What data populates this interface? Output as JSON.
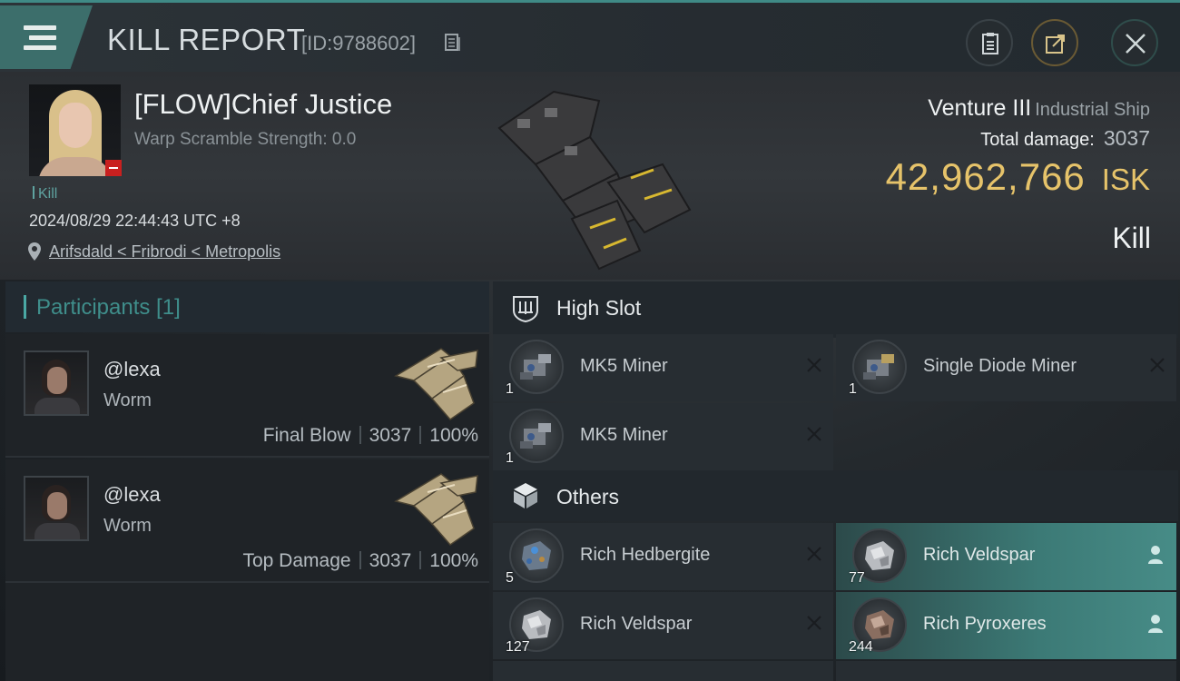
{
  "header": {
    "title": "KILL REPORT",
    "report_id": "[ID:9788602]"
  },
  "victim": {
    "name": "[FLOW]Chief Justice",
    "warp_scramble": "Warp Scramble Strength: 0.0",
    "kill_tag": "Kill",
    "datetime": "2024/08/29 22:44:43 UTC +8",
    "location": "Arifsdald < Fribrodi < Metropolis",
    "ship_name": "Venture III",
    "ship_class": "Industrial Ship",
    "total_damage_label": "Total damage:",
    "total_damage": "3037",
    "isk_value": "42,962,766",
    "isk_unit": "ISK",
    "kill_type": "Kill"
  },
  "participants": {
    "title": "Participants [1]",
    "list": [
      {
        "name": "@lexa",
        "ship": "Worm",
        "role": "Final Blow",
        "damage": "3037",
        "percent": "100%"
      },
      {
        "name": "@lexa",
        "ship": "Worm",
        "role": "Top Damage",
        "damage": "3037",
        "percent": "100%"
      }
    ]
  },
  "high_slot": {
    "title": "High Slot",
    "items": [
      {
        "name": "MK5 Miner",
        "qty": "1",
        "status": "destroyed"
      },
      {
        "name": "Single Diode Miner",
        "qty": "1",
        "status": "destroyed"
      },
      {
        "name": "MK5 Miner",
        "qty": "1",
        "status": "destroyed"
      }
    ]
  },
  "others": {
    "title": "Others",
    "items": [
      {
        "name": "Rich Hedbergite",
        "qty": "5",
        "status": "destroyed"
      },
      {
        "name": "Rich Veldspar",
        "qty": "77",
        "status": "dropped"
      },
      {
        "name": "Rich Veldspar",
        "qty": "127",
        "status": "destroyed"
      },
      {
        "name": "Rich Pyroxeres",
        "qty": "244",
        "status": "dropped"
      }
    ]
  },
  "colors": {
    "accent": "#3f8a86",
    "isk": "#e6c36a",
    "dropped": "#478c87"
  }
}
